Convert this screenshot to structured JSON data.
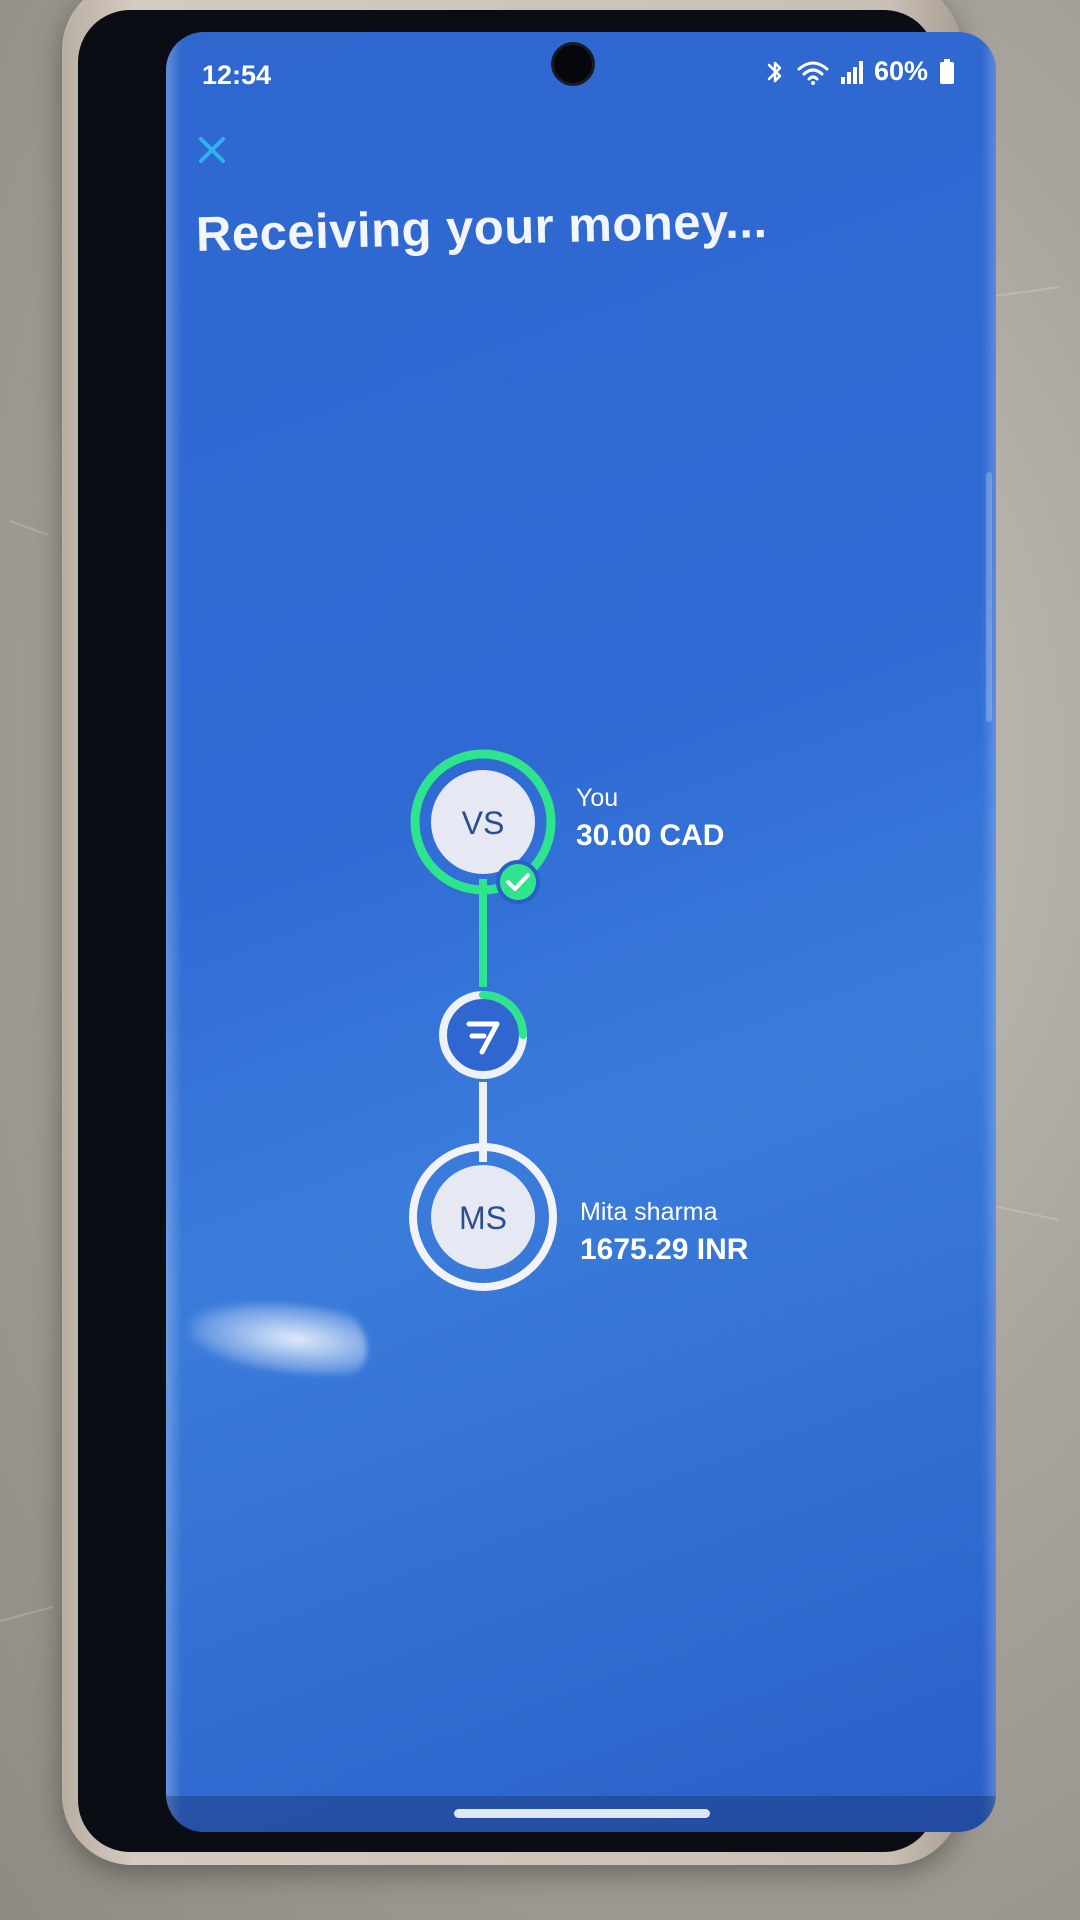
{
  "status_bar": {
    "time": "12:54",
    "battery_percent": "60%",
    "icons": [
      "bluetooth-icon",
      "wifi-icon",
      "signal-icon",
      "battery-icon"
    ]
  },
  "header": {
    "close_icon": "close-icon",
    "title": "Receiving your money..."
  },
  "transfer": {
    "sender": {
      "initials": "VS",
      "label": "You",
      "amount": "30.00 CAD",
      "completed": true
    },
    "intermediary": {
      "icon": "wise-logo-icon",
      "progress": 0.25
    },
    "recipient": {
      "initials": "MS",
      "label": "Mita sharma",
      "amount": "1675.29 INR"
    }
  },
  "colors": {
    "background": "#2f6ad4",
    "accent_green": "#2ee58e",
    "avatar_fill": "#e6e9f3",
    "close_icon": "#2fb3f0"
  }
}
